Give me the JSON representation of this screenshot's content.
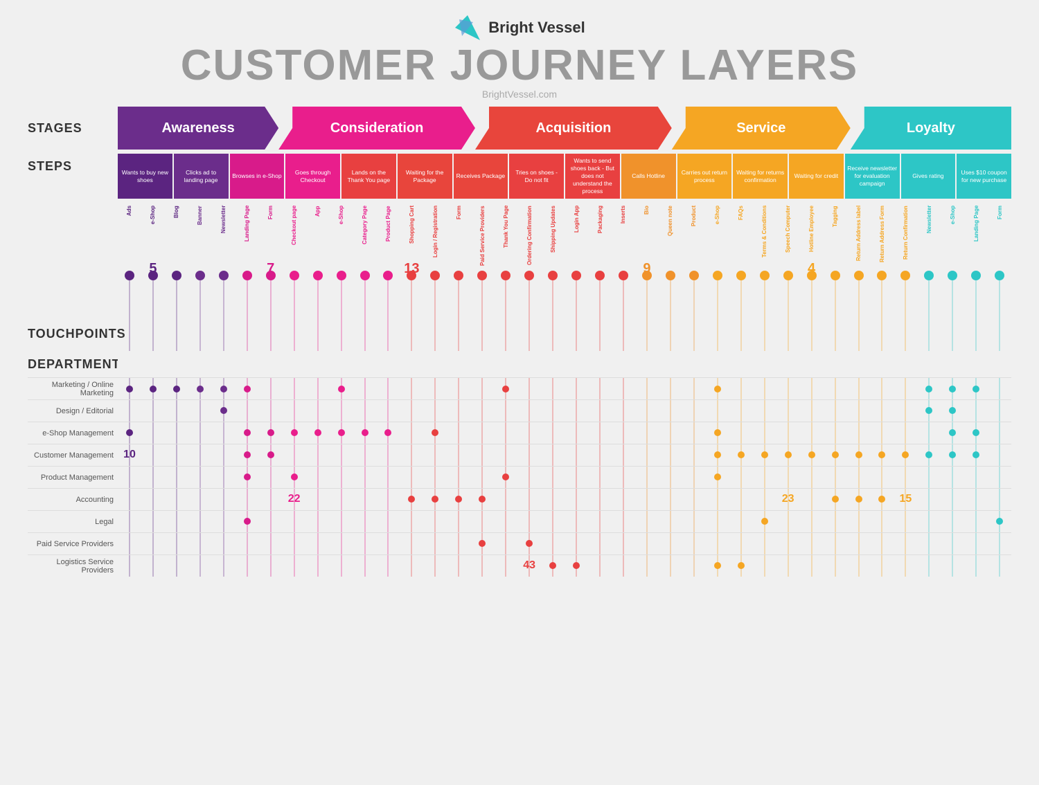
{
  "header": {
    "logo_text": "Bright Vessel",
    "title": "CUSTOMER JOURNEY LAYERS",
    "subtitle": "BrightVessel.com"
  },
  "stages": {
    "label": "STAGES",
    "items": [
      {
        "id": "awareness",
        "label": "Awareness",
        "color": "#6B2D8B",
        "arrow_color": "#6B2D8B"
      },
      {
        "id": "consideration",
        "label": "Consideration",
        "color": "#E91E8C",
        "arrow_color": "#E91E8C"
      },
      {
        "id": "acquisition",
        "label": "Acquisition",
        "color": "#E8453C",
        "arrow_color": "#E8453C"
      },
      {
        "id": "service",
        "label": "Service",
        "color": "#F5A623",
        "arrow_color": "#F5A623"
      },
      {
        "id": "loyalty",
        "label": "Loyalty",
        "color": "#2DC6C6",
        "arrow_color": "#2DC6C6"
      }
    ]
  },
  "steps": {
    "label": "STEPS",
    "items": [
      {
        "text": "Wants to buy new shoes",
        "color": "#5B2480"
      },
      {
        "text": "Clicks ad to landing page",
        "color": "#6B2D8B"
      },
      {
        "text": "Browses in e-Shop",
        "color": "#D81B8A"
      },
      {
        "text": "Goes through Checkout",
        "color": "#E91E8C"
      },
      {
        "text": "Lands on the Thank You page",
        "color": "#E84040"
      },
      {
        "text": "Waiting for the Package",
        "color": "#E8453C"
      },
      {
        "text": "Receives Package",
        "color": "#E8453C"
      },
      {
        "text": "Tries on shoes - Do not fit",
        "color": "#E84040"
      },
      {
        "text": "Wants to send shoes back - But does not understand the process",
        "color": "#E84040"
      },
      {
        "text": "Calls Hotline",
        "color": "#F0922B"
      },
      {
        "text": "Carries out return process",
        "color": "#F5A623"
      },
      {
        "text": "Waiting for returns confirmation",
        "color": "#F5A623"
      },
      {
        "text": "Waiting for credit",
        "color": "#F5A623"
      },
      {
        "text": "Receive newsletter for evaluation campaign",
        "color": "#2DC6C6"
      },
      {
        "text": "Gives rating",
        "color": "#2DC6C6"
      },
      {
        "text": "Uses $10 coupon for new purchase",
        "color": "#2DC6C6"
      }
    ]
  },
  "touchpoints": {
    "label": "TOUCHPOINTS",
    "count_labels": [
      {
        "col_index": 1,
        "value": "5"
      },
      {
        "col_index": 6,
        "value": "7"
      },
      {
        "col_index": 12,
        "value": "13"
      },
      {
        "col_index": 22,
        "value": "9"
      },
      {
        "col_index": 29,
        "value": "4"
      }
    ],
    "columns": [
      {
        "label": "Ads",
        "color": "#5B2480",
        "stage": "awareness"
      },
      {
        "label": "e-Shop",
        "color": "#5B2480",
        "stage": "awareness"
      },
      {
        "label": "Blog",
        "color": "#5B2480",
        "stage": "awareness"
      },
      {
        "label": "Banner",
        "color": "#6B2D8B",
        "stage": "awareness"
      },
      {
        "label": "Newsletter",
        "color": "#6B2D8B",
        "stage": "awareness"
      },
      {
        "label": "Landing Page",
        "color": "#D81B8A",
        "stage": "consideration"
      },
      {
        "label": "Form",
        "color": "#D81B8A",
        "stage": "consideration"
      },
      {
        "label": "Checkout page",
        "color": "#E91E8C",
        "stage": "consideration"
      },
      {
        "label": "App",
        "color": "#E91E8C",
        "stage": "consideration"
      },
      {
        "label": "e-Shop",
        "color": "#E91E8C",
        "stage": "consideration"
      },
      {
        "label": "Category Page",
        "color": "#E91E8C",
        "stage": "consideration"
      },
      {
        "label": "Product Page",
        "color": "#E91E8C",
        "stage": "consideration"
      },
      {
        "label": "Shopping Cart",
        "color": "#E84040",
        "stage": "acquisition"
      },
      {
        "label": "Login / Registration",
        "color": "#E84040",
        "stage": "acquisition"
      },
      {
        "label": "Form",
        "color": "#E84040",
        "stage": "acquisition"
      },
      {
        "label": "Paid Service Providers",
        "color": "#E84040",
        "stage": "acquisition"
      },
      {
        "label": "Thank You Page",
        "color": "#E84040",
        "stage": "acquisition"
      },
      {
        "label": "Ordering Confirmation",
        "color": "#E84040",
        "stage": "acquisition"
      },
      {
        "label": "Shipping Updates",
        "color": "#E84040",
        "stage": "acquisition"
      },
      {
        "label": "Login App",
        "color": "#E84040",
        "stage": "acquisition"
      },
      {
        "label": "Packaging",
        "color": "#E84040",
        "stage": "acquisition"
      },
      {
        "label": "Inserts",
        "color": "#E84040",
        "stage": "acquisition"
      },
      {
        "label": "Bio",
        "color": "#F0922B",
        "stage": "service"
      },
      {
        "label": "Queen note",
        "color": "#F0922B",
        "stage": "service"
      },
      {
        "label": "Product",
        "color": "#F0922B",
        "stage": "service"
      },
      {
        "label": "e-Shop",
        "color": "#F5A623",
        "stage": "service"
      },
      {
        "label": "FAQs",
        "color": "#F5A623",
        "stage": "service"
      },
      {
        "label": "Terms & Conditions",
        "color": "#F5A623",
        "stage": "service"
      },
      {
        "label": "Speech Computer",
        "color": "#F5A623",
        "stage": "service"
      },
      {
        "label": "Hotline Employee",
        "color": "#F5A623",
        "stage": "service"
      },
      {
        "label": "Tagging",
        "color": "#F5A623",
        "stage": "service"
      },
      {
        "label": "Return Address label",
        "color": "#F5A623",
        "stage": "service"
      },
      {
        "label": "Return Address Form",
        "color": "#F5A623",
        "stage": "service"
      },
      {
        "label": "Return Confirmation",
        "color": "#F5A623",
        "stage": "service"
      },
      {
        "label": "Newsletter",
        "color": "#2DC6C6",
        "stage": "loyalty"
      },
      {
        "label": "e-Shop",
        "color": "#2DC6C6",
        "stage": "loyalty"
      },
      {
        "label": "Landing Page",
        "color": "#2DC6C6",
        "stage": "loyalty"
      },
      {
        "label": "Form",
        "color": "#2DC6C6",
        "stage": "loyalty"
      }
    ]
  },
  "departments": {
    "label": "DEPARTMENTS",
    "rows": [
      {
        "name": "Marketing / Online Marketing",
        "dots": [
          1,
          1,
          1,
          1,
          1,
          1,
          0,
          0,
          0,
          1,
          0,
          0,
          0,
          0,
          0,
          0,
          1,
          0,
          0,
          0,
          0,
          0,
          0,
          0,
          0,
          1,
          0,
          0,
          0,
          0,
          0,
          0,
          0,
          0,
          1,
          1,
          1,
          0
        ],
        "count": null,
        "count_col": null
      },
      {
        "name": "Design / Editorial",
        "dots": [
          0,
          0,
          0,
          0,
          1,
          0,
          0,
          0,
          0,
          0,
          0,
          0,
          0,
          0,
          0,
          0,
          0,
          0,
          0,
          0,
          0,
          0,
          0,
          0,
          0,
          0,
          0,
          0,
          0,
          0,
          0,
          0,
          0,
          0,
          1,
          1,
          0,
          0
        ],
        "count": null,
        "count_col": null
      },
      {
        "name": "e-Shop Management",
        "dots": [
          1,
          0,
          0,
          0,
          0,
          1,
          1,
          1,
          1,
          1,
          1,
          1,
          0,
          1,
          0,
          0,
          0,
          0,
          0,
          0,
          0,
          0,
          0,
          0,
          0,
          1,
          0,
          0,
          0,
          0,
          0,
          0,
          0,
          0,
          0,
          1,
          1,
          0
        ],
        "count": null,
        "count_col": null
      },
      {
        "name": "Customer Management",
        "dots": [
          0,
          0,
          0,
          0,
          0,
          1,
          1,
          0,
          0,
          0,
          0,
          0,
          0,
          0,
          0,
          0,
          0,
          0,
          0,
          0,
          0,
          0,
          0,
          0,
          0,
          1,
          1,
          1,
          1,
          1,
          1,
          1,
          1,
          1,
          1,
          1,
          1,
          0
        ],
        "count": "10",
        "count_col": 0
      },
      {
        "name": "Product Management",
        "dots": [
          0,
          0,
          0,
          0,
          0,
          1,
          0,
          1,
          0,
          0,
          0,
          0,
          0,
          0,
          0,
          0,
          1,
          0,
          0,
          0,
          0,
          0,
          0,
          0,
          0,
          1,
          0,
          0,
          0,
          0,
          0,
          0,
          0,
          0,
          0,
          0,
          0,
          0
        ],
        "count": null,
        "count_col": null
      },
      {
        "name": "Accounting",
        "dots": [
          0,
          0,
          0,
          0,
          0,
          0,
          0,
          0,
          0,
          0,
          0,
          0,
          1,
          1,
          1,
          1,
          0,
          0,
          0,
          0,
          0,
          0,
          0,
          0,
          0,
          0,
          0,
          0,
          0,
          0,
          1,
          1,
          1,
          0,
          0,
          0,
          0,
          0
        ],
        "count": "22",
        "count_col": 7,
        "count2": "23",
        "count2_col": 28,
        "count3": "15",
        "count3_col": 33
      },
      {
        "name": "Legal",
        "dots": [
          0,
          0,
          0,
          0,
          0,
          1,
          0,
          0,
          0,
          0,
          0,
          0,
          0,
          0,
          0,
          0,
          0,
          0,
          0,
          0,
          0,
          0,
          0,
          0,
          0,
          0,
          0,
          1,
          0,
          0,
          0,
          0,
          0,
          0,
          0,
          0,
          0,
          1
        ],
        "count": null,
        "count_col": null
      },
      {
        "name": "Paid Service Providers",
        "dots": [
          0,
          0,
          0,
          0,
          0,
          0,
          0,
          0,
          0,
          0,
          0,
          0,
          0,
          0,
          0,
          1,
          0,
          1,
          0,
          0,
          0,
          0,
          0,
          0,
          0,
          0,
          0,
          0,
          0,
          0,
          0,
          0,
          0,
          0,
          0,
          0,
          0,
          0
        ],
        "count": null,
        "count_col": null
      },
      {
        "name": "Logistics Service Providers",
        "dots": [
          0,
          0,
          0,
          0,
          0,
          0,
          0,
          0,
          0,
          0,
          0,
          0,
          0,
          0,
          0,
          0,
          0,
          1,
          1,
          1,
          0,
          0,
          0,
          0,
          0,
          1,
          1,
          0,
          0,
          0,
          0,
          0,
          0,
          0,
          0,
          0,
          0,
          0
        ],
        "count": "43",
        "count_col": 17
      }
    ]
  },
  "colors": {
    "awareness": "#6B2D8B",
    "consideration": "#E91E8C",
    "acquisition": "#E84040",
    "service": "#F5A623",
    "loyalty": "#2DC6C6",
    "bg": "#f0f0f0",
    "text_dark": "#333333",
    "text_light": "#aaaaaa"
  }
}
